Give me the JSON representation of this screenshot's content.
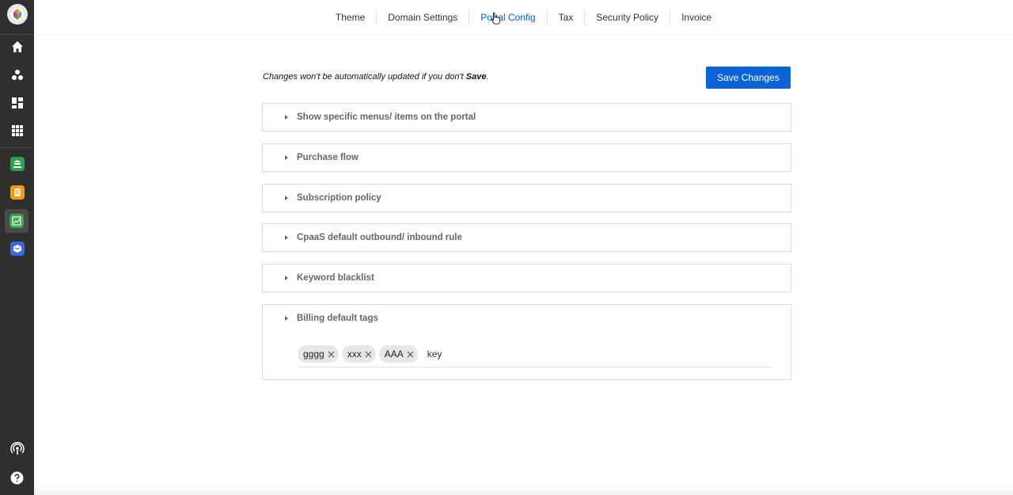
{
  "sidebar": {
    "logo": "brand-logo-icon",
    "nav_icons": [
      "home-icon",
      "users-icon",
      "dashboard-icon",
      "apps-grid-icon"
    ],
    "apps": [
      {
        "icon": "bank-app-icon",
        "color": "#2e9e4f"
      },
      {
        "icon": "document-app-icon",
        "color": "#f29b11"
      },
      {
        "icon": "chart-app-icon",
        "color": "#3fa34d"
      },
      {
        "icon": "box-app-icon",
        "color": "#3b67e0"
      }
    ],
    "bottom_icons": [
      "broadcast-icon",
      "help-icon"
    ]
  },
  "tabs": [
    {
      "label": "Theme",
      "active": false
    },
    {
      "label": "Domain Settings",
      "active": false
    },
    {
      "label": "Portal Config",
      "active": true
    },
    {
      "label": "Tax",
      "active": false
    },
    {
      "label": "Security Policy",
      "active": false
    },
    {
      "label": "Invoice",
      "active": false
    }
  ],
  "main": {
    "notice_text": "Changes won't be automatically updated if you don't ",
    "notice_emphasis": "Save",
    "notice_end": ".",
    "save_button": "Save Changes",
    "panels": [
      {
        "title": "Show specific menus/ items on the portal"
      },
      {
        "title": "Purchase flow"
      },
      {
        "title": "Subscription policy"
      },
      {
        "title": "CpaaS default outbound/ inbound rule"
      },
      {
        "title": "Keyword blacklist"
      },
      {
        "title": "Billing default tags"
      }
    ],
    "billing_tags": [
      "gggg",
      "xxx",
      "AAA"
    ],
    "tag_input_value": "key"
  },
  "colors": {
    "accent": "#0b63d6",
    "sidebar": "#2f2f2f"
  }
}
